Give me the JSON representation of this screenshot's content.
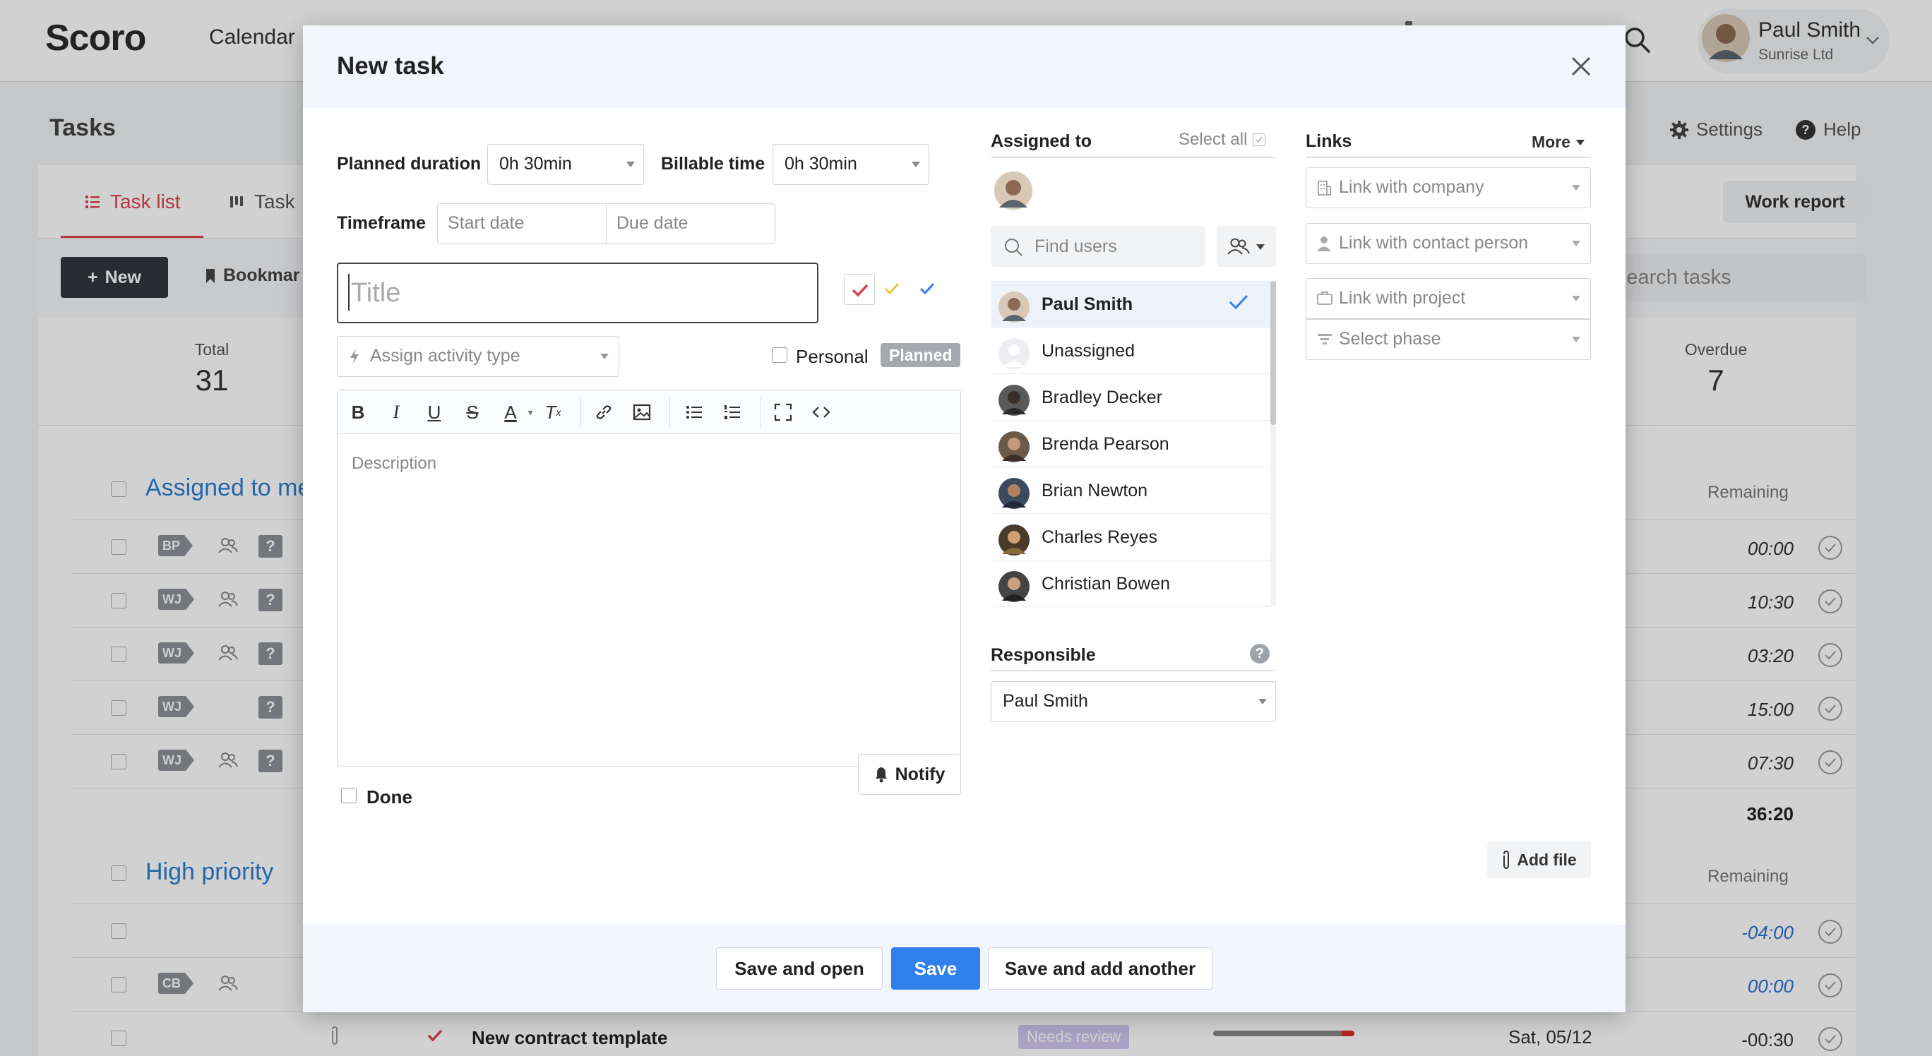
{
  "app": {
    "logo": "Scoro",
    "nav_calendar": "Calendar",
    "user": {
      "name": "Paul Smith",
      "company": "Sunrise Ltd"
    },
    "page_title": "Tasks",
    "settings_label": "Settings",
    "help_label": "Help",
    "tabs": [
      {
        "label": "Task list"
      },
      {
        "label": "Task"
      }
    ],
    "work_report": "Work report",
    "new_label": "New",
    "bookmark_label": "Bookmar",
    "search_placeholder": "Search tasks",
    "stats": [
      {
        "label": "Total",
        "value": "31"
      },
      {
        "label": "Overdue",
        "value": "7"
      }
    ],
    "groups": [
      {
        "title": "Assigned to me",
        "remaining_header": "Remaining",
        "rows": [
          {
            "tag": "BP",
            "remaining": "00:00"
          },
          {
            "tag": "WJ",
            "remaining": "10:30"
          },
          {
            "tag": "WJ",
            "remaining": "03:20"
          },
          {
            "tag": "WJ",
            "remaining": "15:00"
          },
          {
            "tag": "WJ",
            "remaining": "07:30"
          }
        ],
        "total": "36:20"
      },
      {
        "title": "High priority",
        "remaining_header": "Remaining",
        "rows": [
          {
            "tag": "",
            "remaining": "-04:00"
          },
          {
            "tag": "CB",
            "remaining": "00:00"
          },
          {
            "tag": "",
            "remaining": "-00:30",
            "title": "New contract template",
            "status": "Needs review",
            "date": "Sat, 05/12"
          }
        ]
      }
    ]
  },
  "modal": {
    "title": "New task",
    "planned_duration": {
      "label": "Planned duration",
      "value": "0h 30min"
    },
    "billable_time": {
      "label": "Billable time",
      "value": "0h 30min"
    },
    "timeframe": {
      "label": "Timeframe",
      "start_placeholder": "Start date",
      "due_placeholder": "Due date"
    },
    "title_placeholder": "Title",
    "activity_placeholder": "Assign activity type",
    "personal_label": "Personal",
    "planned_badge": "Planned",
    "description_placeholder": "Description",
    "notify_label": "Notify",
    "done_label": "Done",
    "assigned": {
      "title": "Assigned to",
      "select_all": "Select all",
      "find_placeholder": "Find users",
      "users": [
        {
          "name": "Paul Smith",
          "selected": true
        },
        {
          "name": "Unassigned",
          "selected": false
        },
        {
          "name": "Bradley Decker",
          "selected": false
        },
        {
          "name": "Brenda Pearson",
          "selected": false
        },
        {
          "name": "Brian Newton",
          "selected": false
        },
        {
          "name": "Charles Reyes",
          "selected": false
        },
        {
          "name": "Christian Bowen",
          "selected": false
        }
      ]
    },
    "responsible": {
      "title": "Responsible",
      "help": "?",
      "value": "Paul Smith"
    },
    "links": {
      "title": "Links",
      "more": "More",
      "company": "Link with company",
      "contact": "Link with contact person",
      "project": "Link with project",
      "phase": "Select phase"
    },
    "add_file": "Add file",
    "footer": {
      "save_open": "Save and open",
      "save": "Save",
      "save_add": "Save and add another"
    }
  },
  "colors": {
    "accent": "#2f80ed",
    "brand_red": "#d9464d",
    "group_blue": "#2d7dd2"
  }
}
